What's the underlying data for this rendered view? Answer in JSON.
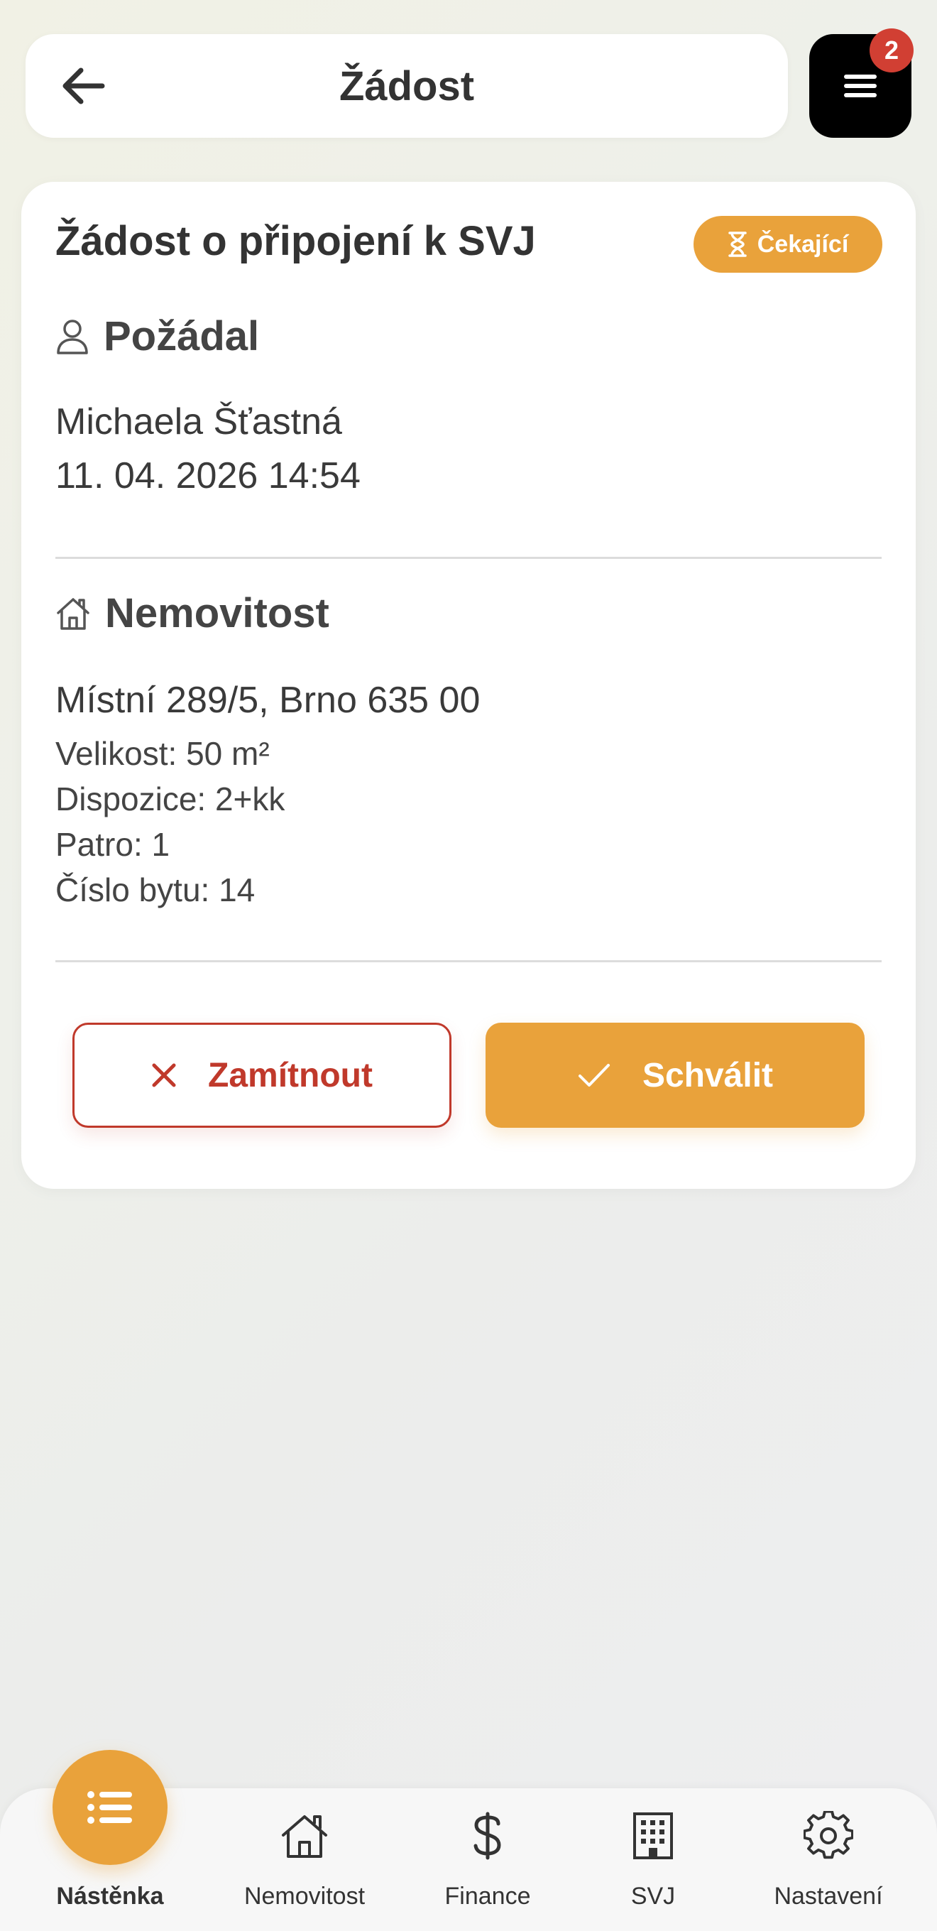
{
  "header": {
    "title": "Žádost",
    "back_icon": "arrow-left-icon",
    "menu_icon": "hamburger-icon",
    "menu_badge_count": "2"
  },
  "request": {
    "title": "Žádost o připojení k SVJ",
    "status": {
      "label": "Čekající",
      "icon": "hourglass-icon",
      "color": "#e9a23b"
    },
    "requester_section": {
      "heading": "Požádal",
      "icon": "user-icon",
      "name": "Michaela Šťastná",
      "datetime": "11. 04. 2026 14:54"
    },
    "property_section": {
      "heading": "Nemovitost",
      "icon": "home-icon",
      "address": "Místní 289/5, Brno 635 00",
      "details": [
        "Velikost: 50 m²",
        "Dispozice: 2+kk",
        "Patro: 1",
        "Číslo bytu: 14"
      ]
    },
    "actions": {
      "reject_label": "Zamítnout",
      "approve_label": "Schválit"
    }
  },
  "bottom_nav": {
    "items": [
      {
        "label": "Nástěnka",
        "icon": "list-icon",
        "active": true
      },
      {
        "label": "Nemovitost",
        "icon": "home-icon"
      },
      {
        "label": "Finance",
        "icon": "dollar-icon"
      },
      {
        "label": "SVJ",
        "icon": "building-icon"
      },
      {
        "label": "Nastavení",
        "icon": "gear-icon"
      }
    ]
  },
  "colors": {
    "accent": "#e9a23b",
    "danger": "#c0392b",
    "badge": "#d13f33"
  }
}
